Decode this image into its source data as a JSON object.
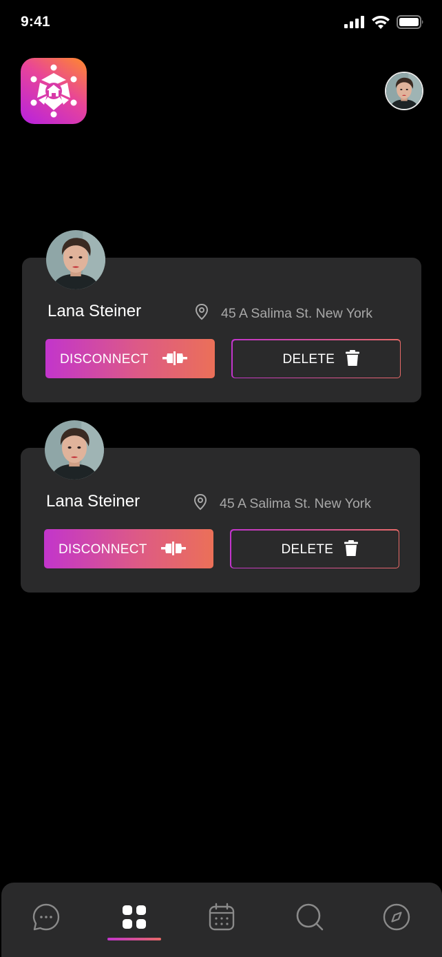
{
  "status_bar": {
    "time": "9:41"
  },
  "header": {
    "logo_icon": "smart-home-hexagon-icon",
    "avatar_icon": "user-avatar"
  },
  "connections": [
    {
      "name": "Lana Steiner",
      "address": "45 A Salima St. New York",
      "disconnect_label": "DISCONNECT",
      "delete_label": "DELETE"
    },
    {
      "name": "Lana Steiner",
      "address": "45 A Salima St. New York",
      "disconnect_label": "DISCONNECT",
      "delete_label": "DELETE"
    }
  ],
  "bottom_nav": {
    "items": [
      {
        "icon": "chat-icon",
        "active": false
      },
      {
        "icon": "grid-icon",
        "active": true
      },
      {
        "icon": "calendar-icon",
        "active": false
      },
      {
        "icon": "search-icon",
        "active": false
      },
      {
        "icon": "compass-icon",
        "active": false
      }
    ]
  },
  "colors": {
    "background": "#000000",
    "card": "#2a2a2b",
    "accent_start": "#c235cc",
    "accent_end": "#eb7058",
    "muted_text": "#a8a8a8"
  }
}
